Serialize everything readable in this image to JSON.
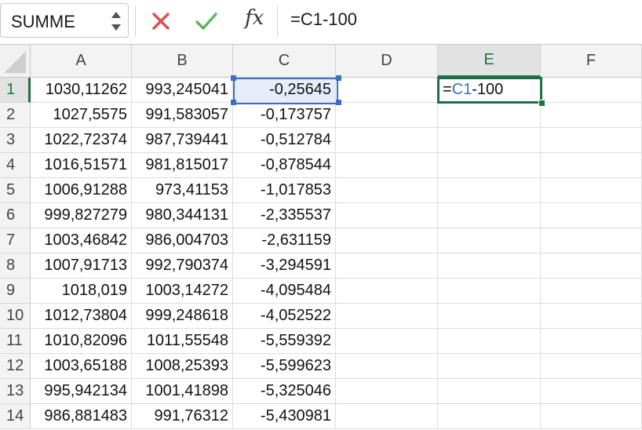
{
  "formula_bar": {
    "name_box": "SUMME",
    "cancel_icon": "x-icon",
    "confirm_icon": "check-icon",
    "function_label": "fx",
    "formula": "=C1-100"
  },
  "columns": [
    "A",
    "B",
    "C",
    "D",
    "E",
    "F"
  ],
  "active_column": "E",
  "active_row": "1",
  "rows": [
    {
      "n": "1",
      "a": "1030,11262",
      "b": "993,245041",
      "c": "-0,25645"
    },
    {
      "n": "2",
      "a": "1027,5575",
      "b": "991,583057",
      "c": "-0,173757"
    },
    {
      "n": "3",
      "a": "1022,72374",
      "b": "987,739441",
      "c": "-0,512784"
    },
    {
      "n": "4",
      "a": "1016,51571",
      "b": "981,815017",
      "c": "-0,878544"
    },
    {
      "n": "5",
      "a": "1006,91288",
      "b": "973,41153",
      "c": "-1,017853"
    },
    {
      "n": "6",
      "a": "999,827279",
      "b": "980,344131",
      "c": "-2,335537"
    },
    {
      "n": "7",
      "a": "1003,46842",
      "b": "986,004703",
      "c": "-2,631159"
    },
    {
      "n": "8",
      "a": "1007,91713",
      "b": "992,790374",
      "c": "-3,294591"
    },
    {
      "n": "9",
      "a": "1018,019",
      "b": "1003,14272",
      "c": "-4,095484"
    },
    {
      "n": "10",
      "a": "1012,73804",
      "b": "999,248618",
      "c": "-4,052522"
    },
    {
      "n": "11",
      "a": "1010,82096",
      "b": "1011,55548",
      "c": "-5,559392"
    },
    {
      "n": "12",
      "a": "1003,65188",
      "b": "1008,25393",
      "c": "-5,599623"
    },
    {
      "n": "13",
      "a": "995,942134",
      "b": "1001,41898",
      "c": "-5,325046"
    },
    {
      "n": "14",
      "a": "986,881483",
      "b": "991,76312",
      "c": "-5,430981"
    }
  ],
  "edit_cell": {
    "eq": "=",
    "ref": "C1",
    "rest": "-100"
  },
  "colors": {
    "accent_green": "#1e7145",
    "ref_blue": "#3a6fc4",
    "cancel_red": "#d9534f",
    "confirm_green": "#5cb85c"
  }
}
